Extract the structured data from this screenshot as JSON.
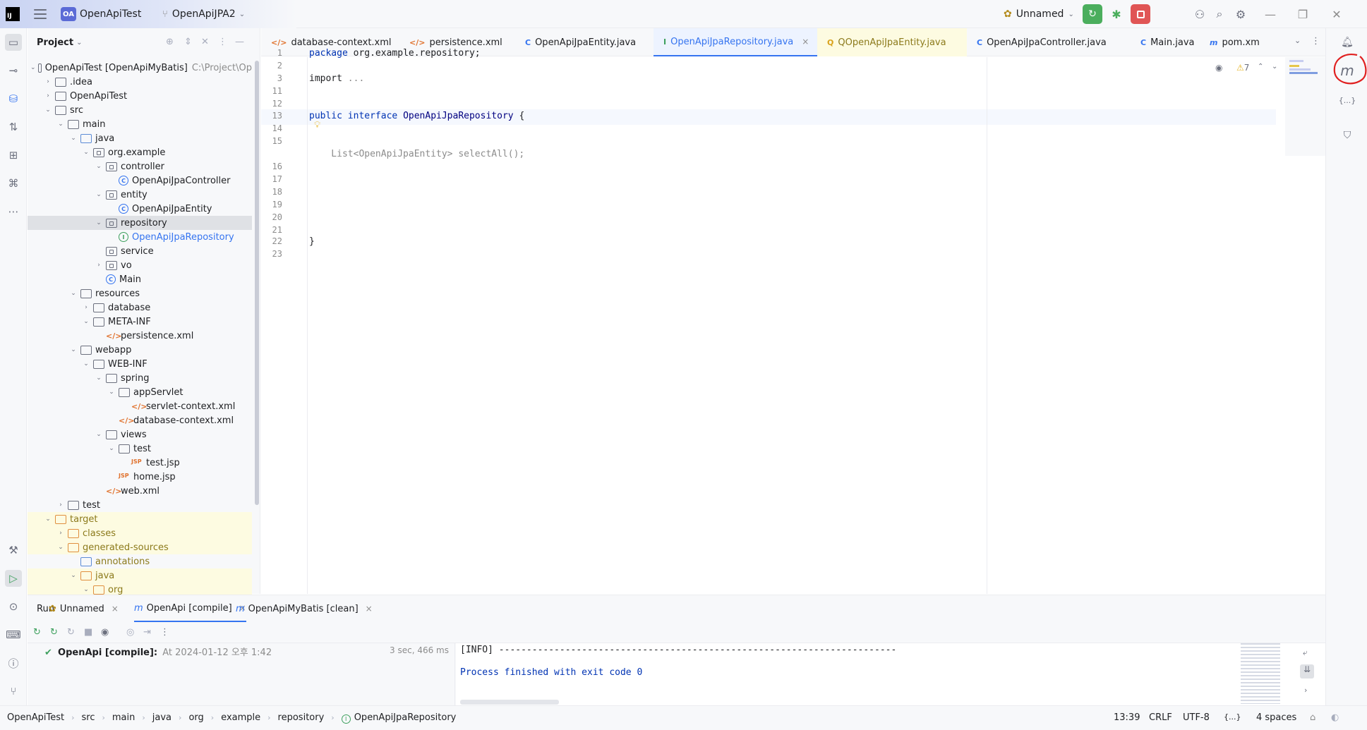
{
  "titlebar": {
    "app_logo": "IJ",
    "project_badge": "OA",
    "project_name": "OpenApiTest",
    "branch": "OpenApiJPA2",
    "run_config": "Unnamed"
  },
  "project_panel": {
    "title": "Project",
    "tree": [
      {
        "label": "OpenApiTest [OpenApiMyBatis]",
        "path": "C:\\Project\\Op",
        "indent": 0,
        "chev": "down",
        "icon": "module"
      },
      {
        "label": ".idea",
        "indent": 1,
        "chev": "right",
        "icon": "folder"
      },
      {
        "label": "OpenApiTest",
        "indent": 1,
        "chev": "right",
        "icon": "folder"
      },
      {
        "label": "src",
        "indent": 1,
        "chev": "down",
        "icon": "folder"
      },
      {
        "label": "main",
        "indent": 2,
        "chev": "down",
        "icon": "folder"
      },
      {
        "label": "java",
        "indent": 3,
        "chev": "down",
        "icon": "folder-blue"
      },
      {
        "label": "org.example",
        "indent": 4,
        "chev": "down",
        "icon": "package"
      },
      {
        "label": "controller",
        "indent": 5,
        "chev": "down",
        "icon": "package"
      },
      {
        "label": "OpenApiJpaController",
        "indent": 6,
        "chev": "",
        "icon": "class"
      },
      {
        "label": "entity",
        "indent": 5,
        "chev": "down",
        "icon": "package"
      },
      {
        "label": "OpenApiJpaEntity",
        "indent": 6,
        "chev": "",
        "icon": "class"
      },
      {
        "label": "repository",
        "indent": 5,
        "chev": "down",
        "icon": "package",
        "selected": true
      },
      {
        "label": "OpenApiJpaRepository",
        "indent": 6,
        "chev": "",
        "icon": "interface",
        "color": "blue"
      },
      {
        "label": "service",
        "indent": 5,
        "chev": "",
        "icon": "package"
      },
      {
        "label": "vo",
        "indent": 5,
        "chev": "right",
        "icon": "package"
      },
      {
        "label": "Main",
        "indent": 5,
        "chev": "",
        "icon": "class"
      },
      {
        "label": "resources",
        "indent": 3,
        "chev": "down",
        "icon": "folder"
      },
      {
        "label": "database",
        "indent": 4,
        "chev": "right",
        "icon": "folder"
      },
      {
        "label": "META-INF",
        "indent": 4,
        "chev": "down",
        "icon": "folder"
      },
      {
        "label": "persistence.xml",
        "indent": 5,
        "chev": "",
        "icon": "xml"
      },
      {
        "label": "webapp",
        "indent": 3,
        "chev": "down",
        "icon": "folder"
      },
      {
        "label": "WEB-INF",
        "indent": 4,
        "chev": "down",
        "icon": "folder"
      },
      {
        "label": "spring",
        "indent": 5,
        "chev": "down",
        "icon": "folder"
      },
      {
        "label": "appServlet",
        "indent": 6,
        "chev": "down",
        "icon": "folder"
      },
      {
        "label": "servlet-context.xml",
        "indent": 7,
        "chev": "",
        "icon": "xml"
      },
      {
        "label": "database-context.xml",
        "indent": 6,
        "chev": "",
        "icon": "xml"
      },
      {
        "label": "views",
        "indent": 5,
        "chev": "down",
        "icon": "folder"
      },
      {
        "label": "test",
        "indent": 6,
        "chev": "down",
        "icon": "folder"
      },
      {
        "label": "test.jsp",
        "indent": 7,
        "chev": "",
        "icon": "jsp"
      },
      {
        "label": "home.jsp",
        "indent": 6,
        "chev": "",
        "icon": "jsp"
      },
      {
        "label": "web.xml",
        "indent": 5,
        "chev": "",
        "icon": "xml"
      },
      {
        "label": "test",
        "indent": 2,
        "chev": "right",
        "icon": "folder"
      },
      {
        "label": "target",
        "indent": 1,
        "chev": "down",
        "icon": "folder-orange",
        "yellow": true,
        "color": "olive"
      },
      {
        "label": "classes",
        "indent": 2,
        "chev": "right",
        "icon": "folder-orange",
        "yellow": true,
        "color": "olive"
      },
      {
        "label": "generated-sources",
        "indent": 2,
        "chev": "down",
        "icon": "folder-orange",
        "yellow": true,
        "color": "olive"
      },
      {
        "label": "annotations",
        "indent": 3,
        "chev": "",
        "icon": "folder-blue",
        "color": "olive"
      },
      {
        "label": "java",
        "indent": 3,
        "chev": "down",
        "icon": "folder-orange",
        "yellow": true,
        "color": "olive"
      },
      {
        "label": "org",
        "indent": 4,
        "chev": "down",
        "icon": "folder-orange",
        "yellow": true,
        "color": "olive"
      }
    ]
  },
  "tabs": [
    {
      "label": "database-context.xml",
      "icon": "</>",
      "kind": "xml"
    },
    {
      "label": "persistence.xml",
      "icon": "</>",
      "kind": "xml"
    },
    {
      "label": "OpenApiJpaEntity.java",
      "icon": "C",
      "kind": "class"
    },
    {
      "label": "OpenApiJpaRepository.java",
      "icon": "I",
      "kind": "interface",
      "active": true
    },
    {
      "label": "QOpenApiJpaEntity.java",
      "icon": "Q",
      "kind": "generated"
    },
    {
      "label": "OpenApiJpaController.java",
      "icon": "C",
      "kind": "class"
    },
    {
      "label": "Main.java",
      "icon": "C",
      "kind": "class"
    },
    {
      "label": "pom.xm",
      "icon": "m",
      "kind": "maven"
    }
  ],
  "editor": {
    "warning_count": "7",
    "lines": [
      {
        "n": "1",
        "parts": [
          [
            "kw",
            "package "
          ],
          [
            "pk",
            "org.example.repository;"
          ]
        ]
      },
      {
        "n": "2",
        "parts": []
      },
      {
        "n": "3",
        "parts": [
          [
            "pk",
            "import "
          ],
          [
            "gray",
            "..."
          ]
        ]
      },
      {
        "n": "11",
        "parts": []
      },
      {
        "n": "12",
        "parts": []
      },
      {
        "n": "13",
        "parts": [
          [
            "kw",
            "public interface "
          ],
          [
            "ty",
            "OpenApiJpaRepository "
          ],
          [
            "pk",
            "{"
          ]
        ]
      },
      {
        "n": "14",
        "parts": []
      },
      {
        "n": "15",
        "parts": []
      },
      {
        "n": "",
        "parts": [
          [
            "gray",
            "    List<OpenApiJpaEntity> selectAll();"
          ]
        ]
      },
      {
        "n": "16",
        "parts": []
      },
      {
        "n": "17",
        "parts": []
      },
      {
        "n": "18",
        "parts": []
      },
      {
        "n": "19",
        "parts": []
      },
      {
        "n": "20",
        "parts": []
      },
      {
        "n": "21",
        "parts": []
      },
      {
        "n": "22",
        "parts": [
          [
            "pk",
            "}"
          ]
        ]
      },
      {
        "n": "23",
        "parts": []
      }
    ]
  },
  "run_panel": {
    "title": "Run",
    "tabs": [
      {
        "label": "Unnamed",
        "icon": "run"
      },
      {
        "label": "OpenApi [compile]",
        "icon": "m",
        "active": true
      },
      {
        "label": "OpenApiMyBatis [clean]",
        "icon": "m"
      }
    ],
    "task": {
      "name": "OpenApi [compile]:",
      "detail": "At 2024-01-12 오후 1:42",
      "duration": "3 sec, 466 ms"
    },
    "console": [
      "[INFO] ------------------------------------------------------------------------",
      "",
      "Process finished with exit code 0"
    ]
  },
  "statusbar": {
    "breadcrumbs": [
      "OpenApiTest",
      "src",
      "main",
      "java",
      "org",
      "example",
      "repository",
      "OpenApiJpaRepository"
    ],
    "position": "13:39",
    "line_sep": "CRLF",
    "encoding": "UTF-8",
    "format_icon": "{...}",
    "indent": "4 spaces"
  }
}
